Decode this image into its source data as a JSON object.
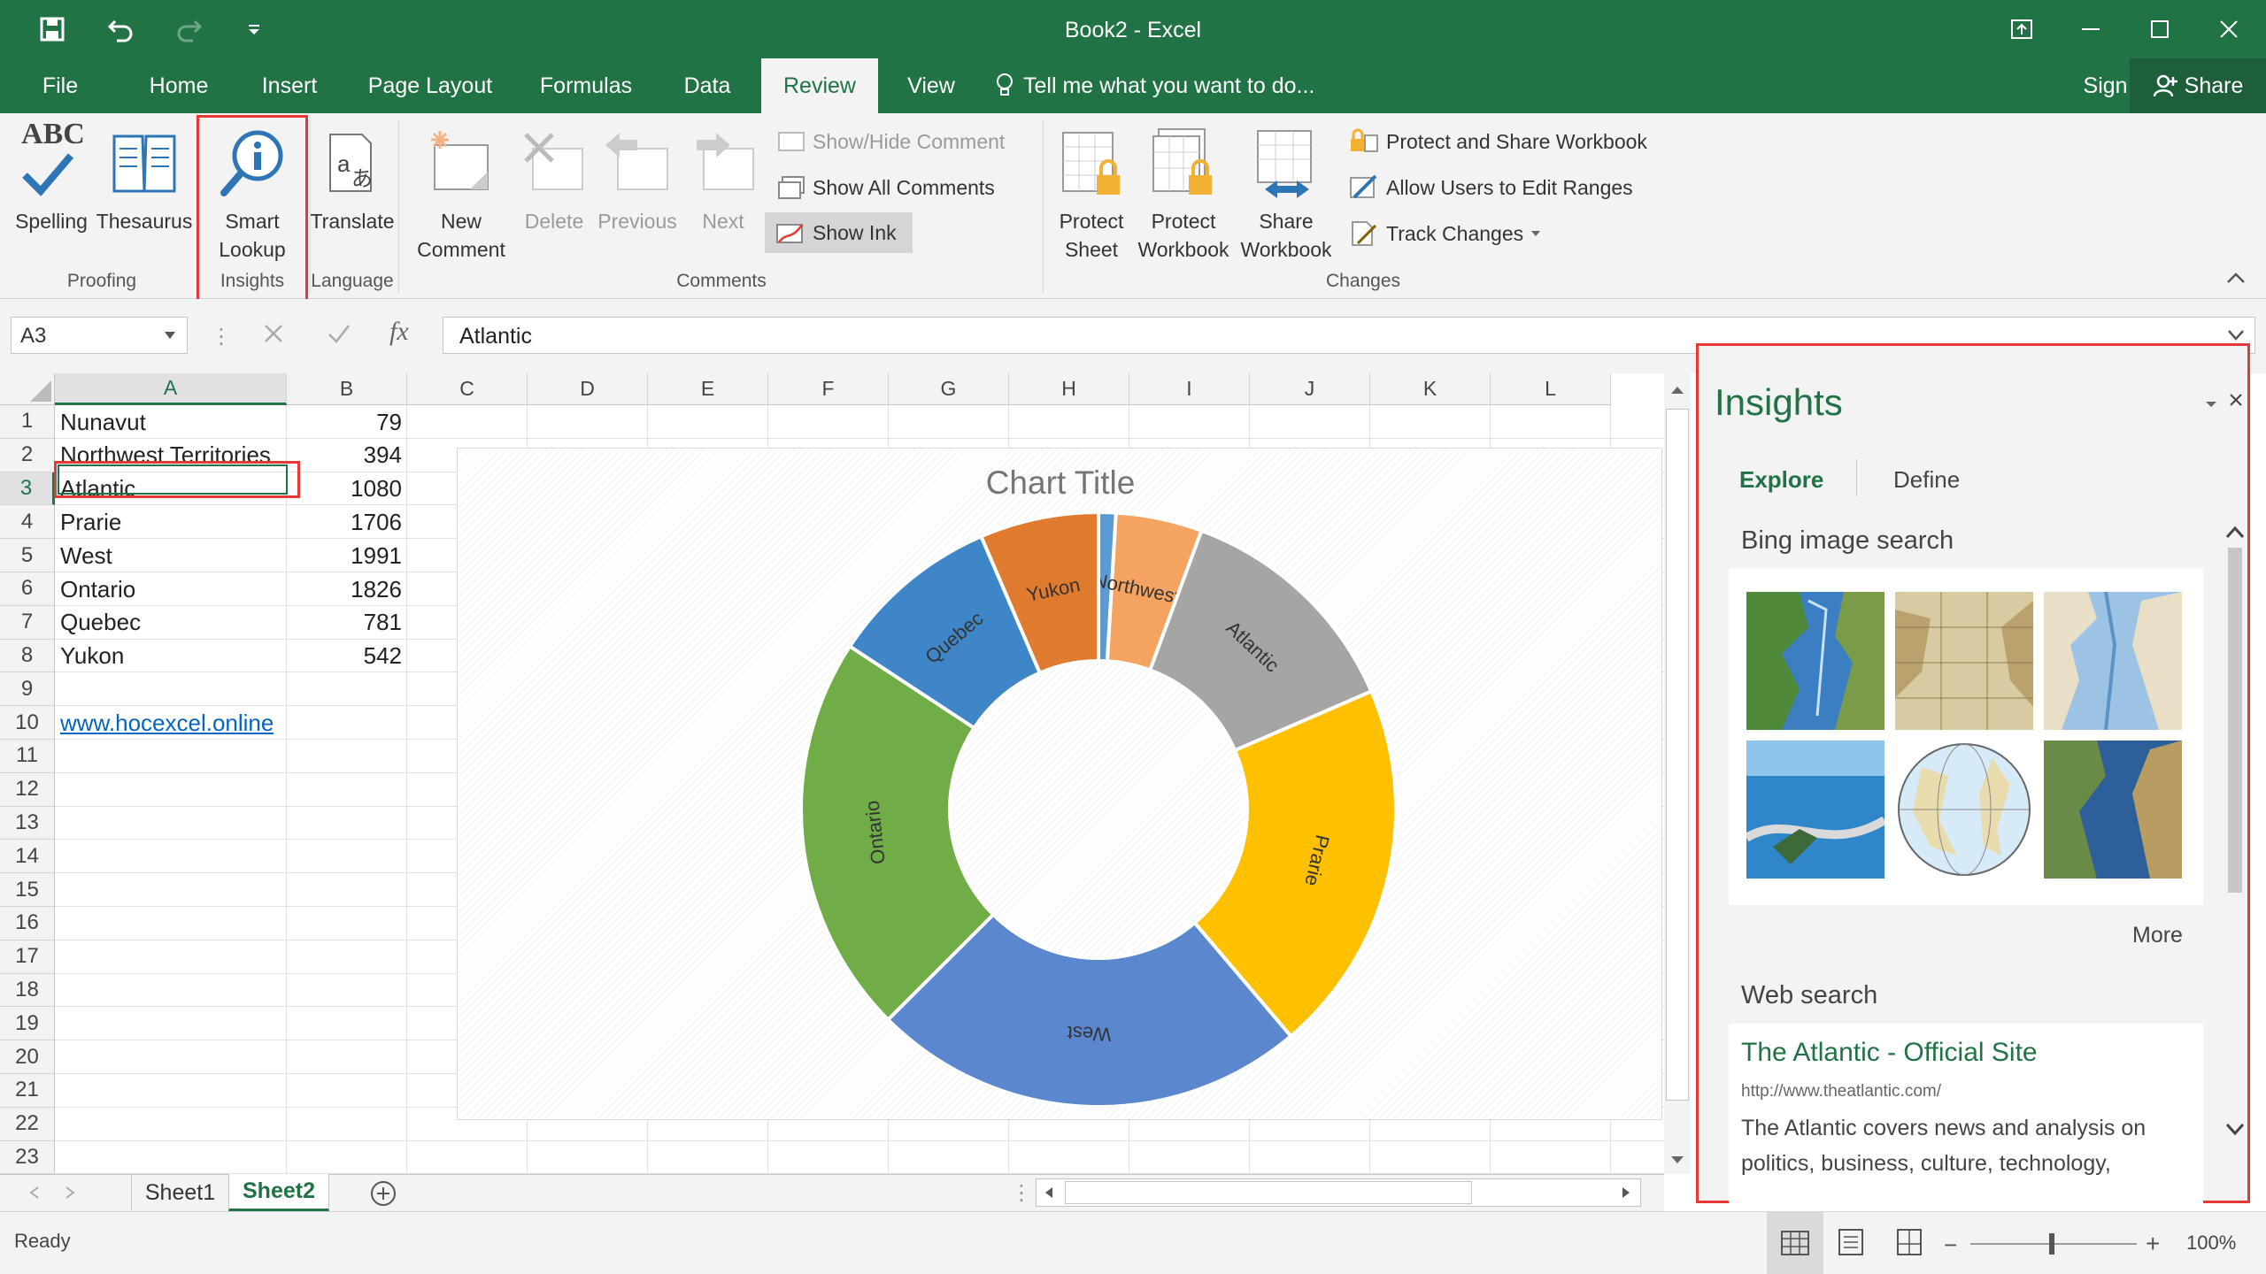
{
  "window": {
    "title": "Book2 - Excel"
  },
  "tabs": [
    "File",
    "Home",
    "Insert",
    "Page Layout",
    "Formulas",
    "Data",
    "Review",
    "View"
  ],
  "tell_me": "Tell me what you want to do...",
  "sign_in": "Sign in",
  "share": "Share",
  "ribbon": {
    "proofing": {
      "spelling": "Spelling",
      "thesaurus": "Thesaurus",
      "group": "Proofing",
      "abc": "ABC"
    },
    "insights": {
      "smart1": "Smart",
      "smart2": "Lookup",
      "group": "Insights"
    },
    "language": {
      "translate": "Translate",
      "group": "Language"
    },
    "comments": {
      "new1": "New",
      "new2": "Comment",
      "delete": "Delete",
      "previous": "Previous",
      "next": "Next",
      "show_hide": "Show/Hide Comment",
      "show_all": "Show All Comments",
      "show_ink": "Show Ink",
      "group": "Comments"
    },
    "changes": {
      "protect_sheet1": "Protect",
      "protect_sheet2": "Sheet",
      "protect_wb1": "Protect",
      "protect_wb2": "Workbook",
      "share_wb1": "Share",
      "share_wb2": "Workbook",
      "protect_share": "Protect and Share Workbook",
      "allow_users": "Allow Users to Edit Ranges",
      "track": "Track Changes",
      "group": "Changes"
    }
  },
  "formula": {
    "name_box": "A3",
    "fx": "fx",
    "value": "Atlantic"
  },
  "columns": [
    "A",
    "B",
    "C",
    "D",
    "E",
    "F",
    "G",
    "H",
    "I",
    "J",
    "K",
    "L"
  ],
  "rows": [
    "1",
    "2",
    "3",
    "4",
    "5",
    "6",
    "7",
    "8",
    "9",
    "10",
    "11",
    "12",
    "13",
    "14",
    "15",
    "16",
    "17",
    "18",
    "19",
    "20",
    "21",
    "22",
    "23"
  ],
  "cells": [
    {
      "a": "Nunavut",
      "b": "79"
    },
    {
      "a": "Northwest Territories",
      "b": "394"
    },
    {
      "a": "Atlantic",
      "b": "1080"
    },
    {
      "a": "Prarie",
      "b": "1706"
    },
    {
      "a": "West",
      "b": "1991"
    },
    {
      "a": "Ontario",
      "b": "1826"
    },
    {
      "a": "Quebec",
      "b": "781"
    },
    {
      "a": "Yukon",
      "b": "542"
    }
  ],
  "link": "www.hocexcel.online",
  "chart_data": {
    "type": "pie",
    "title": "Chart Title",
    "categories": [
      "Nunavut",
      "Northwest...",
      "Atlantic",
      "Prarie",
      "West",
      "Ontario",
      "Quebec",
      "Yukon"
    ],
    "values": [
      79,
      394,
      1080,
      1706,
      1991,
      1826,
      781,
      542
    ],
    "colors": [
      "#5b9bd5",
      "#f4a460",
      "#a5a5a5",
      "#ffc000",
      "#5b87cf",
      "#70ad47",
      "#3f86c8",
      "#e07a2f"
    ]
  },
  "sheets": [
    "Sheet1",
    "Sheet2"
  ],
  "status": {
    "ready": "Ready",
    "zoom": "100%"
  },
  "pane": {
    "title": "Insights",
    "tab_explore": "Explore",
    "tab_define": "Define",
    "bing": "Bing image search",
    "more": "More",
    "web": "Web search",
    "result_title": "The Atlantic - Official Site",
    "result_url": "http://www.theatlantic.com/",
    "result_line1": "The Atlantic covers news and analysis on",
    "result_line2": "politics, business, culture, technology,"
  }
}
